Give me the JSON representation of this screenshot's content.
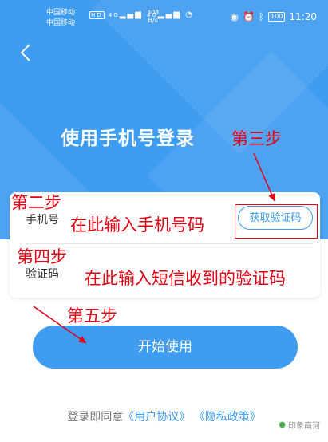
{
  "statusbar": {
    "carrier1": "中国移动",
    "carrier2": "中国移动",
    "net_badge": "HD",
    "net_type1": "4G",
    "net_type2": "4G",
    "speed_value": "308",
    "speed_unit": "B/s",
    "battery": "100",
    "time": "11:20"
  },
  "hero": {
    "title": "使用手机号登录"
  },
  "form": {
    "phone_label": "手机号",
    "code_label": "验证码",
    "get_code_label": "获取验证码"
  },
  "annotations": {
    "step2": "第二步",
    "step2_text": "在此输入手机号码",
    "step3": "第三步",
    "step4": "第四步",
    "step4_text": "在此输入短信收到的验证码",
    "step5": "第五步"
  },
  "start_button": {
    "label": "开始使用"
  },
  "agreement": {
    "prefix": "登录即同意",
    "user_agreement": "《用户协议》",
    "privacy_policy": "《隐私政策》"
  },
  "watermark": "印象南河",
  "colors": {
    "primary": "#3e9cf1",
    "annotation": "#e60012"
  }
}
